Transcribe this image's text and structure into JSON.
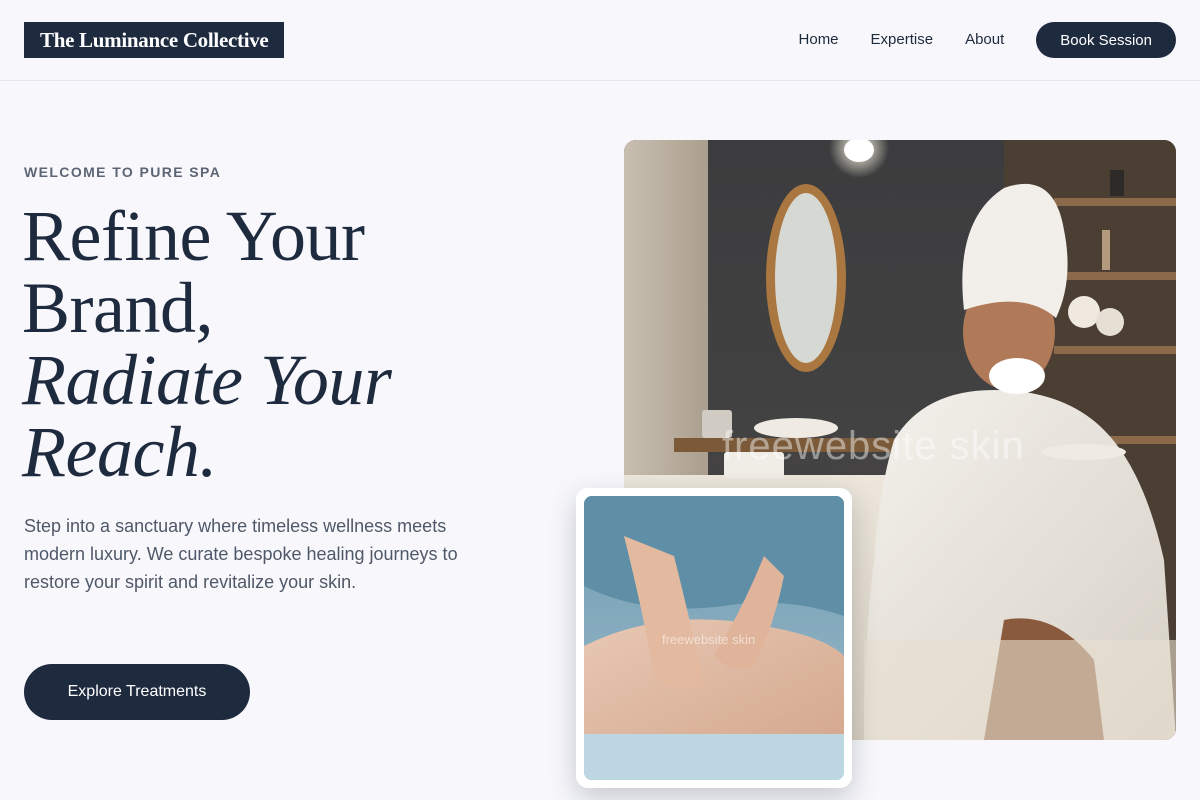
{
  "header": {
    "logo_text": "The Luminance Collective",
    "nav": [
      {
        "label": "Home"
      },
      {
        "label": "Expertise"
      },
      {
        "label": "About"
      }
    ],
    "cta_label": "Book Session"
  },
  "hero": {
    "eyebrow": "WELCOME TO PURE SPA",
    "headline": {
      "line1": "Refine Your",
      "line2": "Brand,",
      "line3": "Radiate Your",
      "line4": "Reach."
    },
    "intro": "Step into a sanctuary where timeless wellness meets modern luxury. We curate bespoke healing journeys to restore your spirit and revitalize your skin.",
    "cta_label": "Explore Treatments"
  },
  "images": {
    "main_alt": "Woman in white robe and towel turban sipping tea in a spa room",
    "inset_alt": "Therapist giving a back massage",
    "watermark": "freewebsite skin",
    "watermark_small": "freewebsite skin"
  },
  "colors": {
    "brand": "#1e2a3e",
    "background": "#f8f8fc",
    "muted_text": "#4f5868",
    "eyebrow_text": "#5d6575"
  }
}
